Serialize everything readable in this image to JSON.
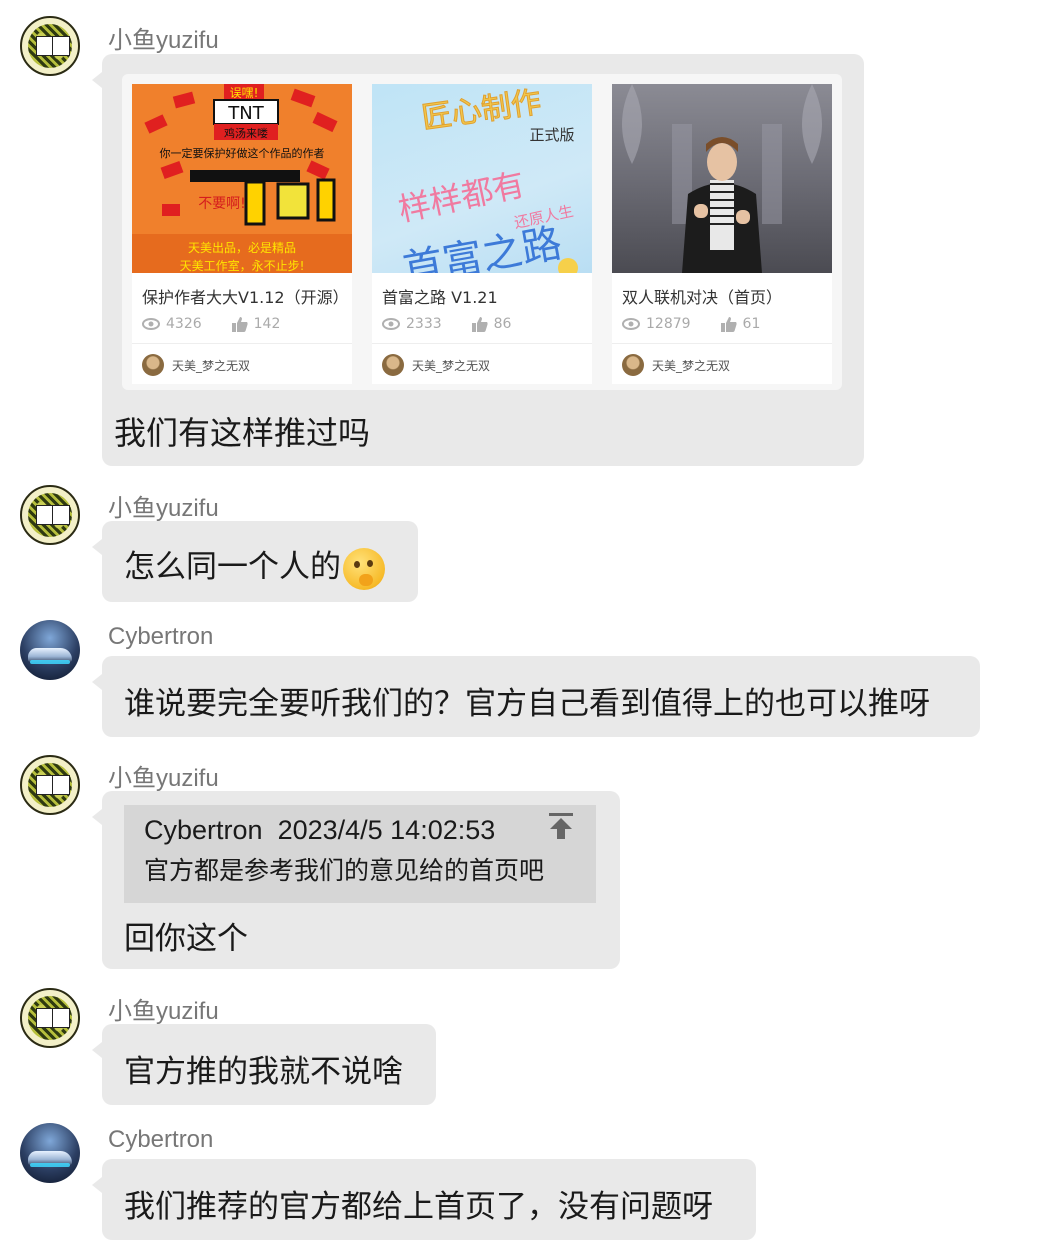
{
  "messages": [
    {
      "sender": "小鱼yuzifu",
      "works": [
        {
          "title": "保护作者大大V1.12（开源）",
          "views": "4326",
          "likes": "142",
          "author": "天美_梦之无双",
          "thumb_text": [
            "误嘿!",
            "TNT",
            "鸡汤来喽",
            "你一定要保护好做这个作品的作者",
            "不要啊!",
            "天美出品，必是精品",
            "天美工作室，永不止步!"
          ]
        },
        {
          "title": "首富之路 V1.21",
          "views": "2333",
          "likes": "86",
          "author": "天美_梦之无双",
          "thumb_text": [
            "匠心制作",
            "正式版",
            "样样都有",
            "还原人生",
            "首富之路"
          ]
        },
        {
          "title": "双人联机对决（首页）",
          "views": "12879",
          "likes": "61",
          "author": "天美_梦之无双"
        }
      ],
      "text": "我们有这样推过吗"
    },
    {
      "sender": "小鱼yuzifu",
      "text": "怎么同一个人的"
    },
    {
      "sender": "Cybertron",
      "text": "谁说要完全要听我们的？官方自己看到值得上的也可以推呀"
    },
    {
      "sender": "小鱼yuzifu",
      "quote": {
        "author": "Cybertron",
        "time": "2023/4/5 14:02:53",
        "text": "官方都是参考我们的意见给的首页吧"
      },
      "text": "回你这个"
    },
    {
      "sender": "小鱼yuzifu",
      "text": "官方推的我就不说啥"
    },
    {
      "sender": "Cybertron",
      "text": "我们推荐的官方都给上首页了，没有问题呀"
    }
  ],
  "icons": {
    "views": "eye-icon",
    "likes": "thumbs-up-icon",
    "quote_jump": "arrow-to-top-icon",
    "emoji": "thinking-face-emoji"
  },
  "colors": {
    "bubble": "#e9e9e9",
    "name": "#777777",
    "quote_bg": "#d6d6d6"
  }
}
